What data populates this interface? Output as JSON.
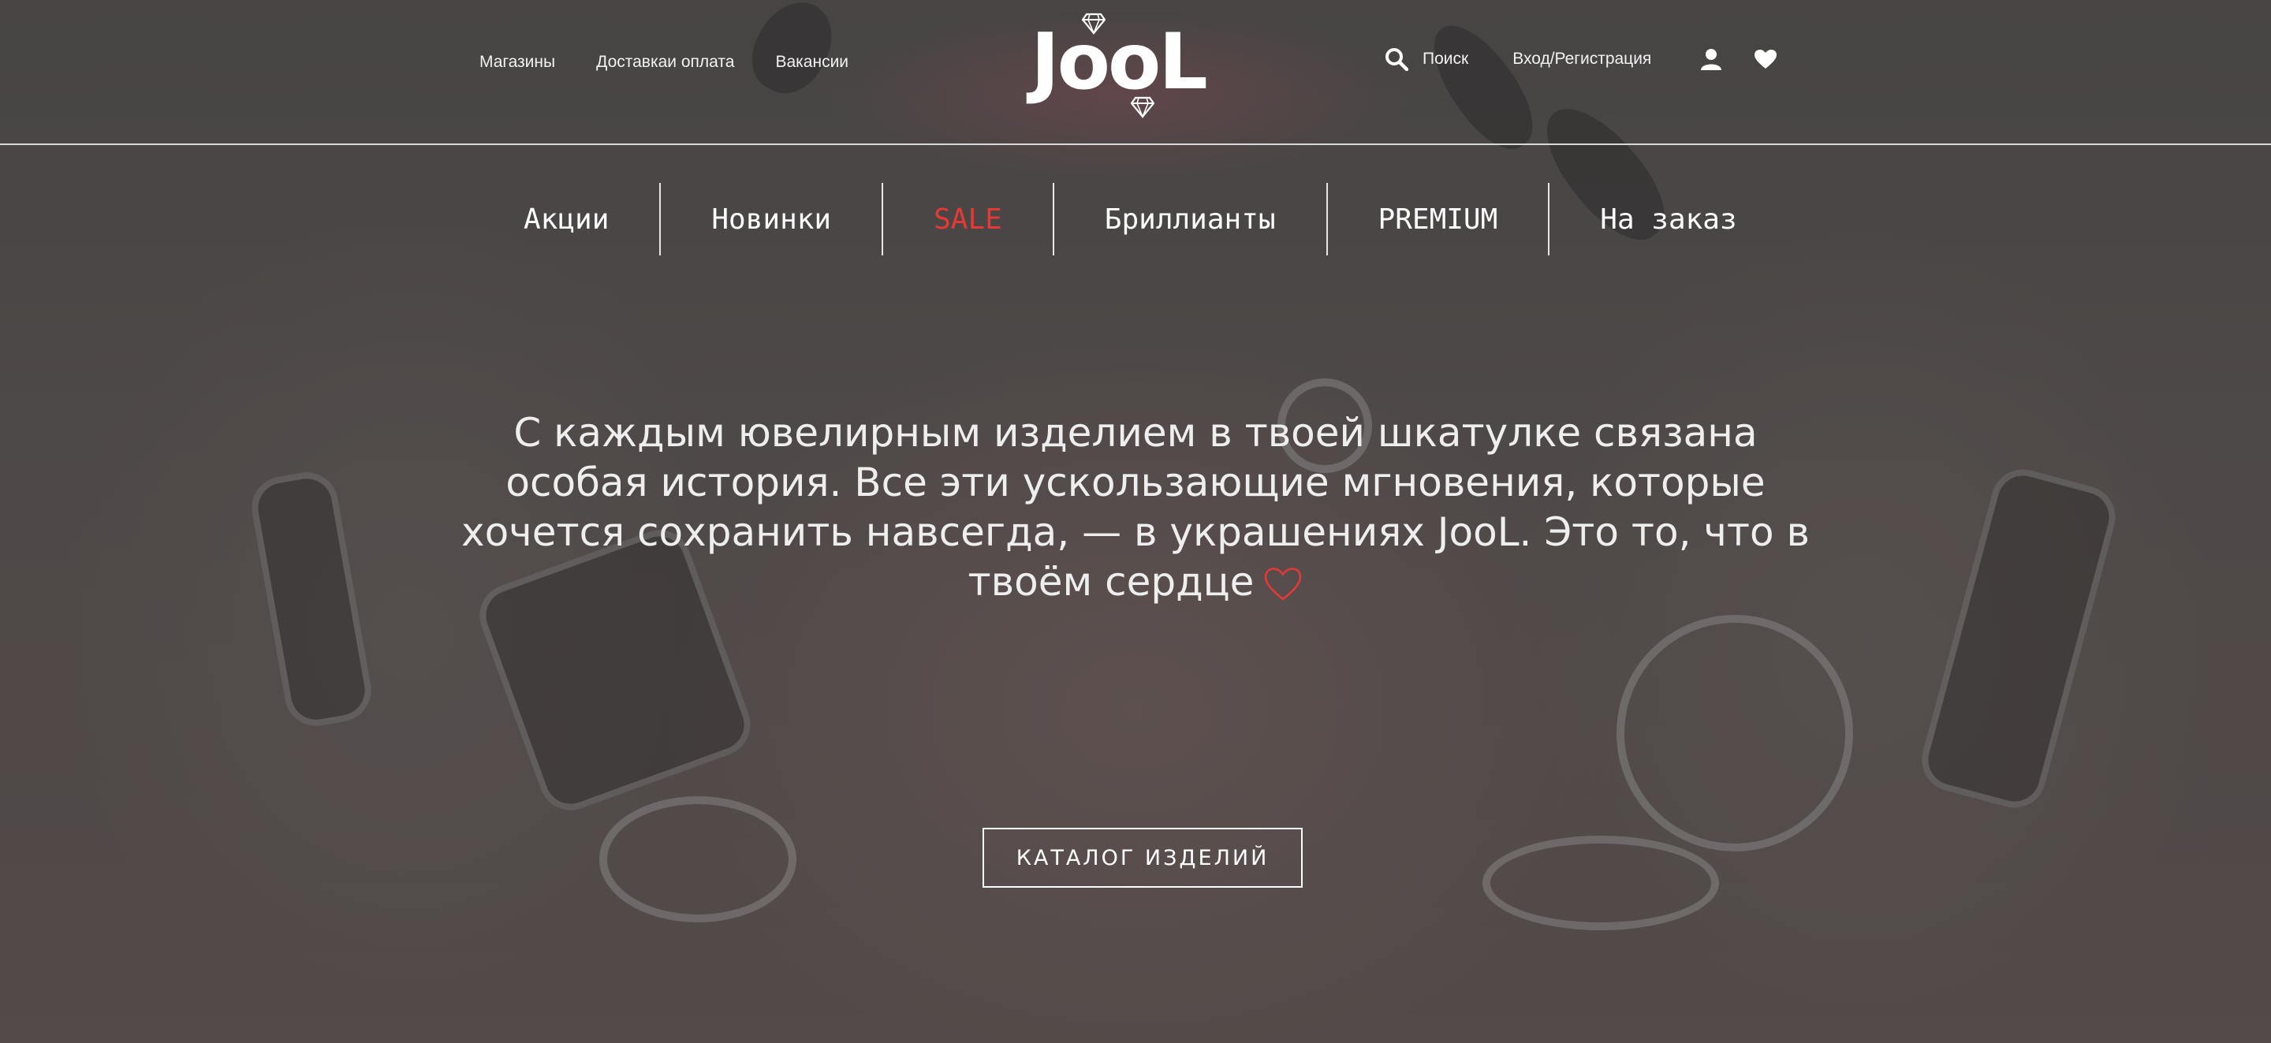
{
  "colors": {
    "accent_red": "#e53935",
    "text_white": "#ffffff",
    "overlay": "#4c4a49"
  },
  "header": {
    "nav_links": [
      "Магазины",
      "Доставкаи оплата",
      "Вакансии"
    ],
    "logo": "JooL",
    "search_label": "Поиск",
    "login_label": "Вход/Регистрация",
    "icons": [
      "search-icon",
      "user-icon",
      "heart-icon",
      "diamond-icon"
    ]
  },
  "categories": [
    "Акции",
    "Новинки",
    "SALE",
    "Бриллианты",
    "PREMIUM",
    "На заказ"
  ],
  "hero": {
    "text": "С каждым ювелирным изделием в твоей шкатулке связана особая история. Все эти ускользающие мгновения, которые хочется сохранить навсегда, — в украшениях JooL. Это то, что в твоём сердце"
  },
  "cta": {
    "catalog_label": "КАТАЛОГ ИЗДЕЛИЙ"
  }
}
